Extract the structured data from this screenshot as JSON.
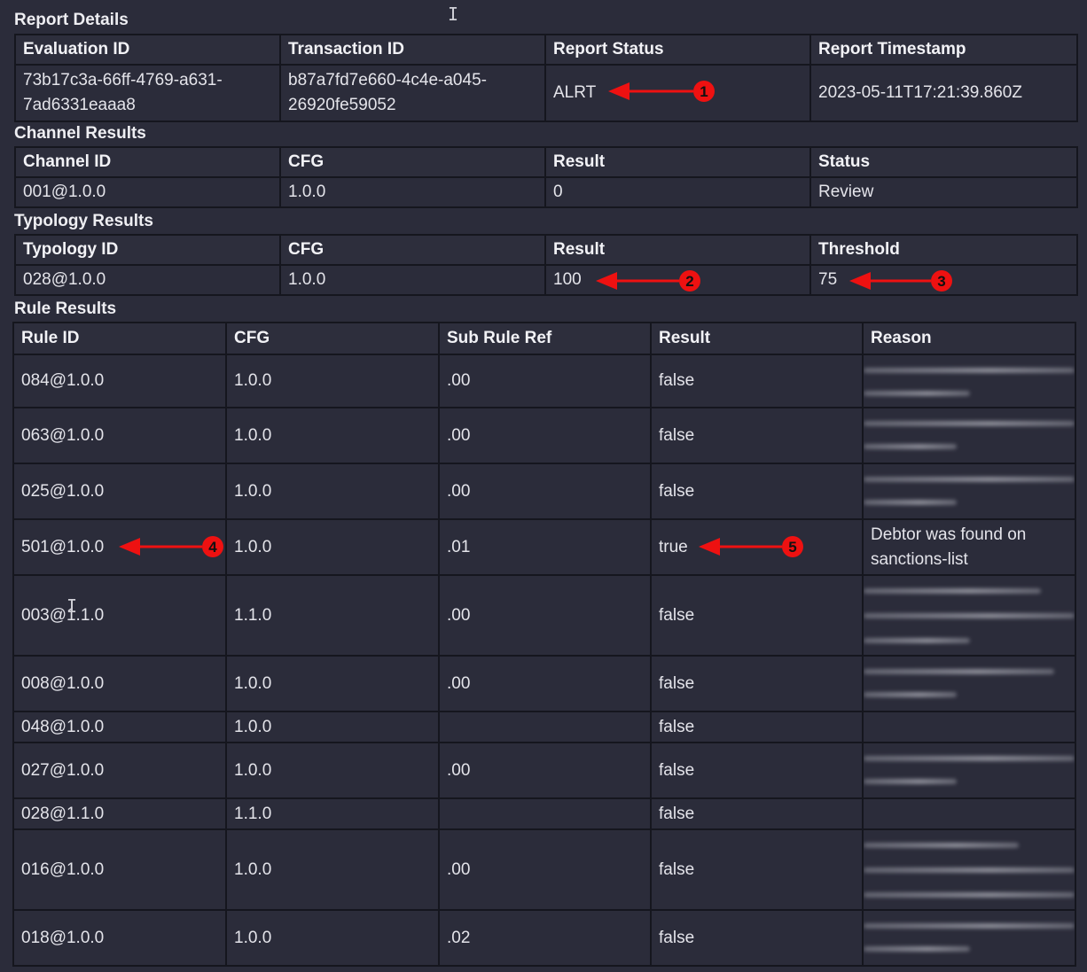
{
  "report_details": {
    "title": "Report Details",
    "headers": [
      "Evaluation ID",
      "Transaction ID",
      "Report Status",
      "Report Timestamp"
    ],
    "evaluation_id_line1": "73b17c3a-66ff-4769-a631-",
    "evaluation_id_line2": "7ad6331eaaa8",
    "transaction_id_line1": "b87a7fd7e660-4c4e-a045-",
    "transaction_id_line2": "26920fe59052",
    "report_status": "ALRT",
    "report_timestamp": "2023-05-11T17:21:39.860Z"
  },
  "channel_results": {
    "title": "Channel Results",
    "headers": [
      "Channel ID",
      "CFG",
      "Result",
      "Status"
    ],
    "row": [
      "001@1.0.0",
      "1.0.0",
      "0",
      "Review"
    ]
  },
  "typology_results": {
    "title": "Typology Results",
    "headers": [
      "Typology ID",
      "CFG",
      "Result",
      "Threshold"
    ],
    "row": [
      "028@1.0.0",
      "1.0.0",
      "100",
      "75"
    ]
  },
  "rule_results": {
    "title": "Rule Results",
    "headers": [
      "Rule ID",
      "CFG",
      "Sub Rule Ref",
      "Result",
      "Reason"
    ],
    "rows": [
      {
        "rule_id": "084@1.0.0",
        "cfg": "1.0.0",
        "sub_rule_ref": ".00",
        "result": "false",
        "reason": ""
      },
      {
        "rule_id": "063@1.0.0",
        "cfg": "1.0.0",
        "sub_rule_ref": ".00",
        "result": "false",
        "reason": ""
      },
      {
        "rule_id": "025@1.0.0",
        "cfg": "1.0.0",
        "sub_rule_ref": ".00",
        "result": "false",
        "reason": ""
      },
      {
        "rule_id": "501@1.0.0",
        "cfg": "1.0.0",
        "sub_rule_ref": ".01",
        "result": "true",
        "reason": "Debtor was found on sanctions-list"
      },
      {
        "rule_id": "003@1.1.0",
        "cfg": "1.1.0",
        "sub_rule_ref": ".00",
        "result": "false",
        "reason": ""
      },
      {
        "rule_id": "008@1.0.0",
        "cfg": "1.0.0",
        "sub_rule_ref": ".00",
        "result": "false",
        "reason": ""
      },
      {
        "rule_id": "048@1.0.0",
        "cfg": "1.0.0",
        "sub_rule_ref": "",
        "result": "false",
        "reason": ""
      },
      {
        "rule_id": "027@1.0.0",
        "cfg": "1.0.0",
        "sub_rule_ref": ".00",
        "result": "false",
        "reason": ""
      },
      {
        "rule_id": "028@1.1.0",
        "cfg": "1.1.0",
        "sub_rule_ref": "",
        "result": "false",
        "reason": ""
      },
      {
        "rule_id": "016@1.0.0",
        "cfg": "1.0.0",
        "sub_rule_ref": ".00",
        "result": "false",
        "reason": ""
      },
      {
        "rule_id": "018@1.0.0",
        "cfg": "1.0.0",
        "sub_rule_ref": ".02",
        "result": "false",
        "reason": ""
      }
    ]
  },
  "annotations": {
    "color": "#ee1111",
    "markers": [
      "1",
      "2",
      "3",
      "4",
      "5"
    ]
  }
}
